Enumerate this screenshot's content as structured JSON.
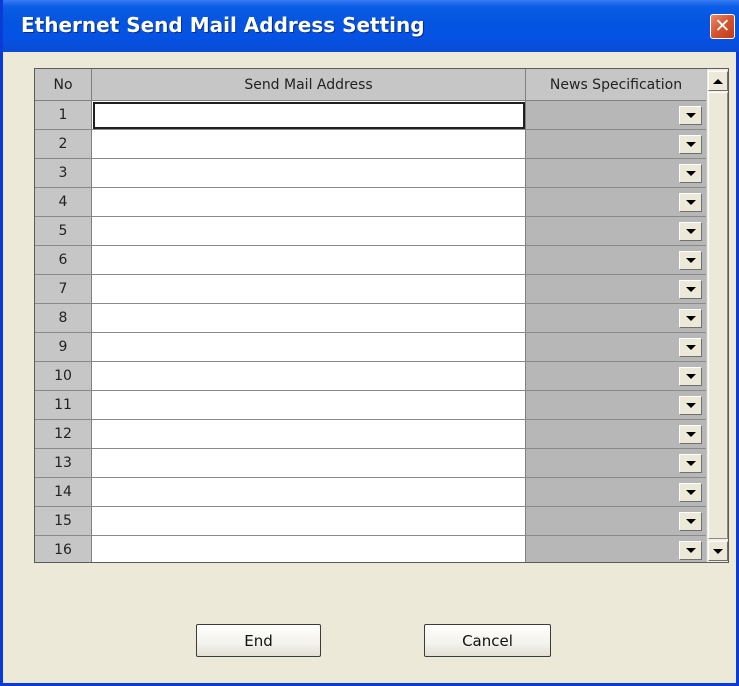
{
  "window": {
    "title": "Ethernet Send Mail Address Setting",
    "close_symbol": "✕"
  },
  "grid": {
    "columns": {
      "no": "No",
      "address": "Send Mail Address",
      "news": "News Specification"
    },
    "rows": [
      {
        "no": "1",
        "address": "",
        "news": ""
      },
      {
        "no": "2",
        "address": "",
        "news": ""
      },
      {
        "no": "3",
        "address": "",
        "news": ""
      },
      {
        "no": "4",
        "address": "",
        "news": ""
      },
      {
        "no": "5",
        "address": "",
        "news": ""
      },
      {
        "no": "6",
        "address": "",
        "news": ""
      },
      {
        "no": "7",
        "address": "",
        "news": ""
      },
      {
        "no": "8",
        "address": "",
        "news": ""
      },
      {
        "no": "9",
        "address": "",
        "news": ""
      },
      {
        "no": "10",
        "address": "",
        "news": ""
      },
      {
        "no": "11",
        "address": "",
        "news": ""
      },
      {
        "no": "12",
        "address": "",
        "news": ""
      },
      {
        "no": "13",
        "address": "",
        "news": ""
      },
      {
        "no": "14",
        "address": "",
        "news": ""
      },
      {
        "no": "15",
        "address": "",
        "news": ""
      },
      {
        "no": "16",
        "address": "",
        "news": ""
      }
    ],
    "focused_row": 1
  },
  "buttons": {
    "end": "End",
    "cancel": "Cancel"
  },
  "icons": {
    "close": "close-icon",
    "dropdown": "chevron-down-icon",
    "scroll_up": "scroll-up-icon",
    "scroll_down": "scroll-down-icon"
  }
}
